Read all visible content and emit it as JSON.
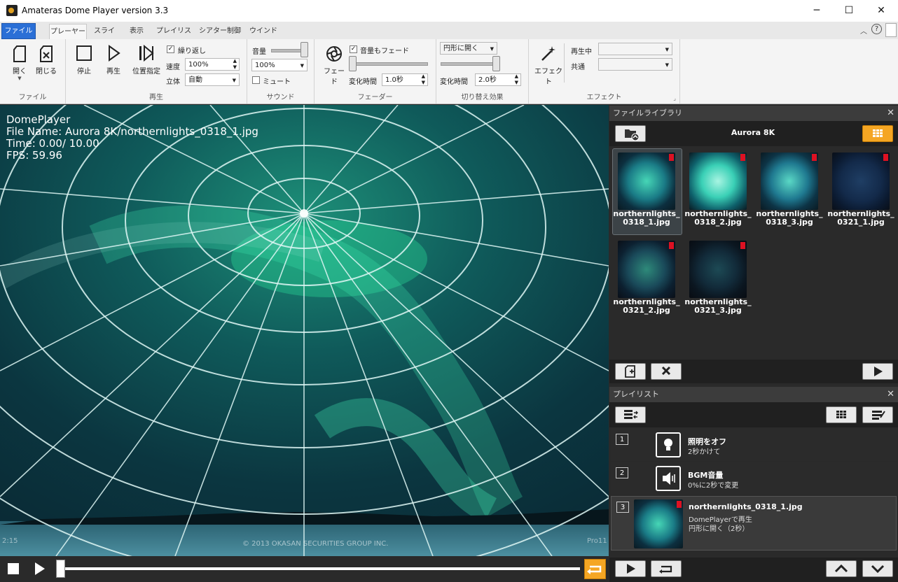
{
  "window": {
    "title": "Amateras Dome Player version 3.3",
    "minimize": "─",
    "maximize": "☐",
    "close": "✕"
  },
  "menu": {
    "file": "ファイル",
    "tabs": [
      "プレーヤー",
      "スライド",
      "表示",
      "プレイリスト",
      "シアター制御",
      "ウインドウ"
    ],
    "help": "?"
  },
  "ribbon": {
    "file_group": {
      "open": "開く",
      "close": "閉じる",
      "label": "ファイル"
    },
    "play_group": {
      "stop": "停止",
      "play": "再生",
      "seek": "位置指定",
      "repeat": "繰り返し",
      "speed_label": "速度",
      "speed_value": "100%",
      "stereo_label": "立体",
      "stereo_value": "自動",
      "label": "再生"
    },
    "sound_group": {
      "volume_label": "音量",
      "volume_value": "100%",
      "mute": "ミュート",
      "label": "サウンド"
    },
    "fader_group": {
      "fade": "フェード",
      "volume_fade": "音量もフェード",
      "time_label": "変化時間",
      "time_value": "1.0秒",
      "label": "フェーダー"
    },
    "transition_group": {
      "mode": "円形に開く",
      "time_label": "変化時間",
      "time_value": "2.0秒",
      "label": "切り替え効果"
    },
    "effect_group": {
      "effect": "エフェクト",
      "playing_label": "再生中",
      "common_label": "共通",
      "label": "エフェクト"
    }
  },
  "viewer": {
    "line1": "DomePlayer",
    "line2": "File Name: Aurora 8K/northernlights_0318_1.jpg",
    "line3": "Time:   0.00/  10.00",
    "line4": "FPS: 59.96",
    "copyright": "© 2013 OKASAN SECURITIES GROUP INC.",
    "corner_left": "2:15",
    "corner_right": "Pro11"
  },
  "library": {
    "header": "ファイルライブラリ",
    "folder": "Aurora 8K",
    "items": [
      {
        "line1": "northernlights_",
        "line2": "0318_1.jpg"
      },
      {
        "line1": "northernlights_",
        "line2": "0318_2.jpg"
      },
      {
        "line1": "northernlights_",
        "line2": "0318_3.jpg"
      },
      {
        "line1": "northernlights_",
        "line2": "0321_1.jpg"
      },
      {
        "line1": "northernlights_",
        "line2": "0321_2.jpg"
      },
      {
        "line1": "northernlights_",
        "line2": "0321_3.jpg"
      }
    ]
  },
  "playlist": {
    "header": "プレイリスト",
    "items": [
      {
        "num": "1",
        "title": "照明をオフ",
        "sub1": "2秒かけて",
        "sub2": ""
      },
      {
        "num": "2",
        "title": "BGM音量",
        "sub1": "0%に2秒で変更",
        "sub2": ""
      },
      {
        "num": "3",
        "title": "northernlights_0318_1.jpg",
        "sub1": "DomePlayerで再生",
        "sub2": "円形に開く（2秒）"
      }
    ]
  },
  "colors": {
    "accent": "#f5a623",
    "menu_blue": "#2a6fd6",
    "aurora": "#1fc8a0"
  }
}
